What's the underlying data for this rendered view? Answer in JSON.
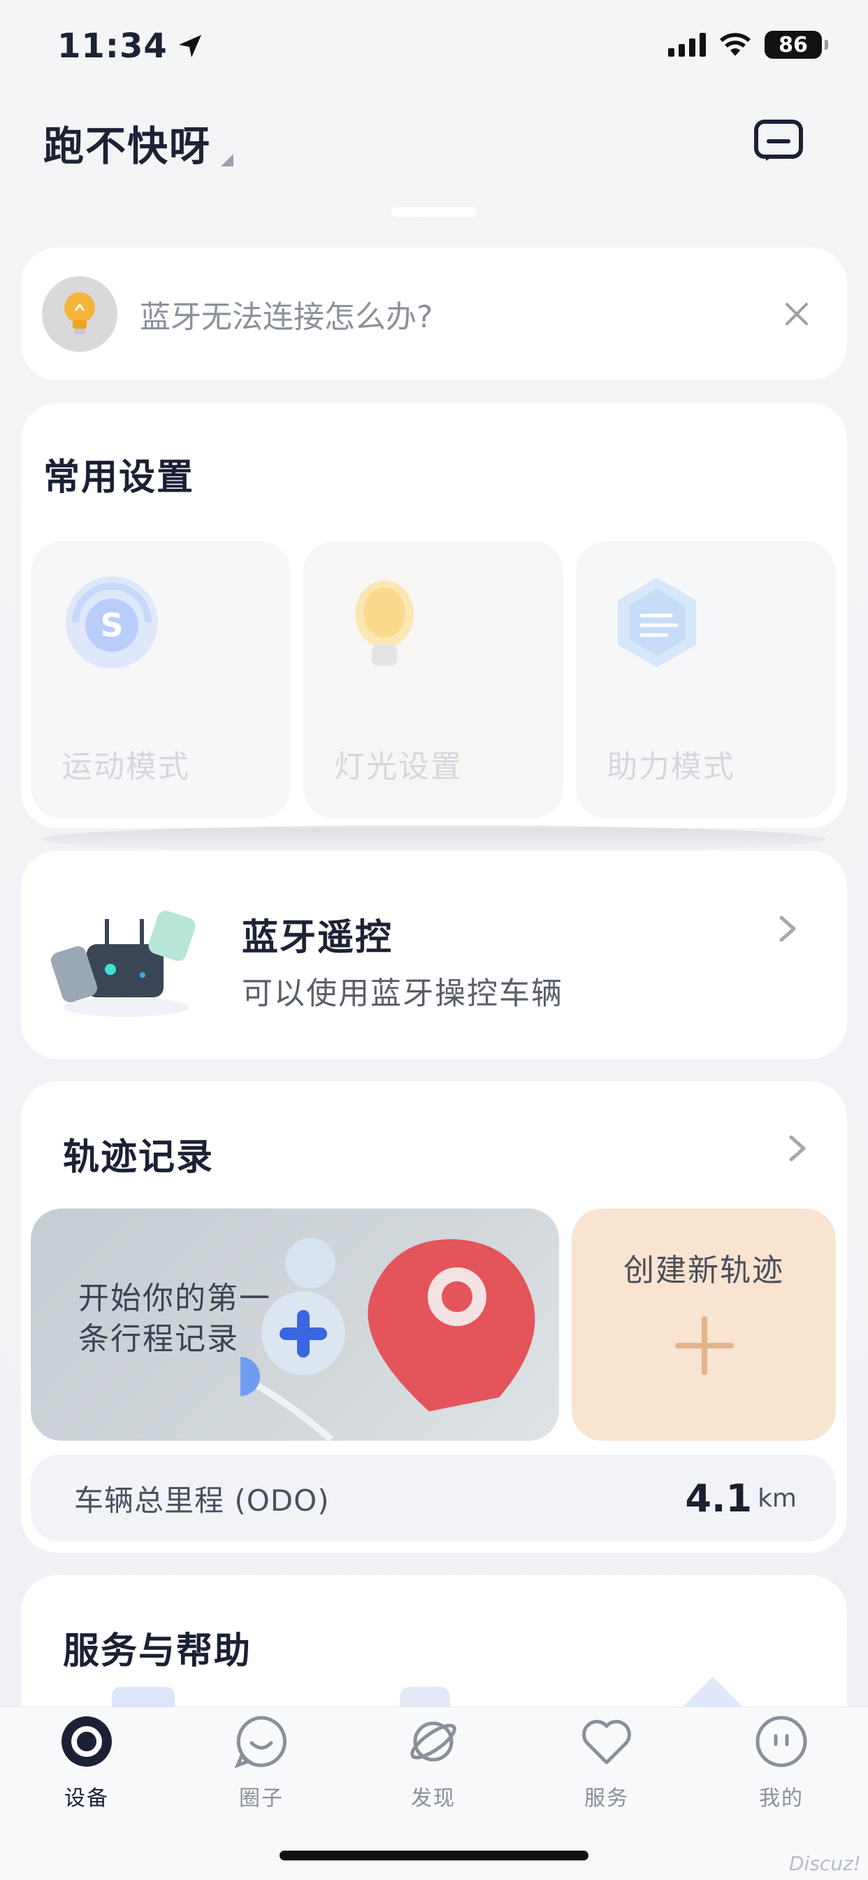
{
  "status_bar": {
    "time": "11:34",
    "battery": "86"
  },
  "header": {
    "title": "跑不快呀"
  },
  "tip": {
    "text": "蓝牙无法连接怎么办?"
  },
  "settings": {
    "title": "常用设置",
    "items": [
      {
        "label": "运动模式",
        "icon": "sport-mode-icon"
      },
      {
        "label": "灯光设置",
        "icon": "light-bulb-icon"
      },
      {
        "label": "助力模式",
        "icon": "assist-mode-icon"
      }
    ]
  },
  "bluetooth": {
    "title": "蓝牙遥控",
    "subtitle": "可以使用蓝牙操控车辆"
  },
  "track": {
    "title": "轨迹记录",
    "banner_line1": "开始你的第一",
    "banner_line2": "条行程记录",
    "create_label": "创建新轨迹",
    "odo_label": "车辆总里程 (ODO)",
    "odo_value": "4.1",
    "odo_unit": "km"
  },
  "service": {
    "title": "服务与帮助"
  },
  "tabs": [
    {
      "label": "设备",
      "active": true
    },
    {
      "label": "圈子",
      "active": false
    },
    {
      "label": "发现",
      "active": false
    },
    {
      "label": "服务",
      "active": false
    },
    {
      "label": "我的",
      "active": false
    }
  ],
  "watermark": "Discuz!",
  "colors": {
    "accent": "#1c2035",
    "tab_inactive": "#8a8f9a",
    "create_tile": "#f9e3d1",
    "plus": "#e2b48a"
  }
}
